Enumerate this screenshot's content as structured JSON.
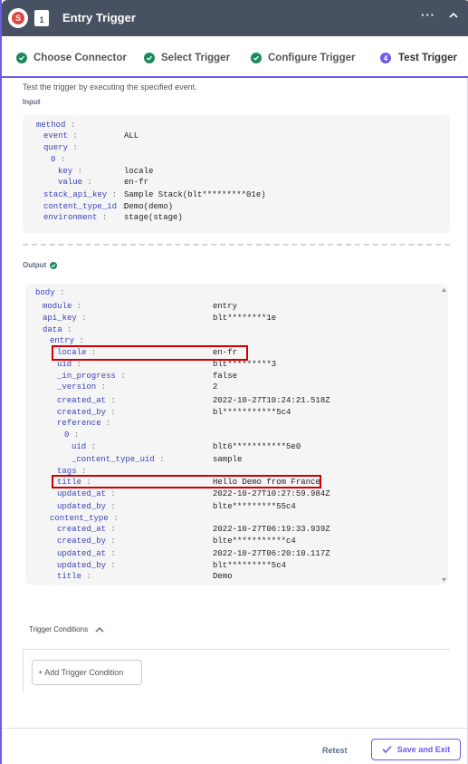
{
  "header": {
    "logo_text": "S",
    "doc_badge": "1",
    "title": "Entry Trigger",
    "more_icon": "ellipsis-icon",
    "collapse_icon": "chevron-up-icon"
  },
  "steps": [
    {
      "label": "Choose Connector",
      "state": "done"
    },
    {
      "label": "Select Trigger",
      "state": "done"
    },
    {
      "label": "Configure Trigger",
      "state": "done"
    },
    {
      "label": "Test Trigger",
      "state": "active",
      "number": "4"
    }
  ],
  "intro": "Test the trigger by executing the specified event.",
  "input": {
    "label": "Input",
    "rows": [
      {
        "key": "method",
        "val": ""
      },
      {
        "key": "event",
        "val": "ALL"
      },
      {
        "key": "query",
        "val": ""
      },
      {
        "key": "0",
        "val": ""
      },
      {
        "key": "key",
        "val": "locale"
      },
      {
        "key": "value",
        "val": "en-fr"
      },
      {
        "key": "stack_api_key",
        "val": "Sample Stack(blt*********01e)"
      },
      {
        "key": "content_type_id",
        "val": "Demo(demo)"
      },
      {
        "key": "environment",
        "val": "stage(stage)"
      }
    ]
  },
  "output": {
    "label": "Output",
    "rows": [
      {
        "key": "body",
        "val": ""
      },
      {
        "key": "module",
        "val": "entry"
      },
      {
        "key": "api_key",
        "val": "blt********1e"
      },
      {
        "key": "data",
        "val": ""
      },
      {
        "key": "entry",
        "val": ""
      },
      {
        "key": "locale",
        "val": "en-fr"
      },
      {
        "key": "uid",
        "val": "blt*********3"
      },
      {
        "key": "_in_progress",
        "val": "false"
      },
      {
        "key": "_version",
        "val": "2"
      },
      {
        "key": "created_at",
        "val": "2022-10-27T10:24:21.518Z"
      },
      {
        "key": "created_by",
        "val": "bl***********5c4"
      },
      {
        "key": "reference",
        "val": ""
      },
      {
        "key": "0",
        "val": ""
      },
      {
        "key": "uid",
        "val": "blt6***********5e0"
      },
      {
        "key": "_content_type_uid",
        "val": "sample"
      },
      {
        "key": "tags",
        "val": ""
      },
      {
        "key": "title",
        "val": "Hello Demo from France"
      },
      {
        "key": "updated_at",
        "val": "2022-10-27T10:27:59.984Z"
      },
      {
        "key": "updated_by",
        "val": "blte*********55c4"
      },
      {
        "key": "content_type",
        "val": ""
      },
      {
        "key": "created_at",
        "val": "2022-10-27T06:19:33.939Z"
      },
      {
        "key": "created_by",
        "val": "blte***********c4"
      },
      {
        "key": "updated_at",
        "val": "2022-10-27T06:20:10.117Z"
      },
      {
        "key": "updated_by",
        "val": "blt*********5c4"
      },
      {
        "key": "title",
        "val": "Demo"
      }
    ]
  },
  "conditions": {
    "label": "Trigger Conditions",
    "add_label": "+ Add Trigger Condition"
  },
  "footer": {
    "retest": "Retest",
    "save": "Save and Exit"
  },
  "colors": {
    "header_bg": "#475161",
    "accent": "#6c5ce7",
    "success": "#1b8a5a",
    "highlight": "#d00000"
  }
}
